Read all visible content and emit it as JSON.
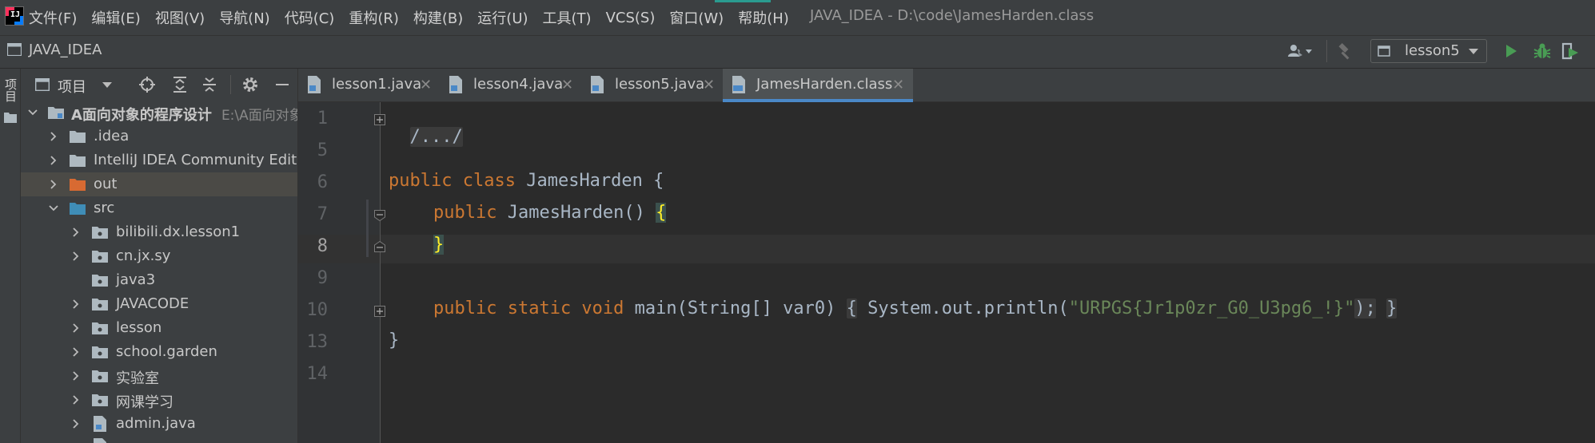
{
  "menu": [
    "文件(F)",
    "编辑(E)",
    "视图(V)",
    "导航(N)",
    "代码(C)",
    "重构(R)",
    "构建(B)",
    "运行(U)",
    "工具(T)",
    "VCS(S)",
    "窗口(W)",
    "帮助(H)"
  ],
  "window_title": "JAVA_IDEA - D:\\code\\JamesHarden.class",
  "nav": {
    "project": "JAVA_IDEA",
    "run_config": "lesson5"
  },
  "tool_strip_label": "项目",
  "project_panel": {
    "title": "项目",
    "tree": [
      {
        "label": "A面向对象的程序设计",
        "hint": "E:\\A面向对象"
      },
      {
        "label": ".idea"
      },
      {
        "label": "IntelliJ IDEA Community Edition"
      },
      {
        "label": "out"
      },
      {
        "label": "src"
      },
      {
        "label": "bilibili.dx.lesson1"
      },
      {
        "label": "cn.jx.sy"
      },
      {
        "label": "java3"
      },
      {
        "label": "JAVACODE"
      },
      {
        "label": "lesson"
      },
      {
        "label": "school.garden"
      },
      {
        "label": "实验室"
      },
      {
        "label": "网课学习"
      },
      {
        "label": "admin.java"
      }
    ]
  },
  "tabs": [
    {
      "label": "lesson1.java"
    },
    {
      "label": "lesson4.java"
    },
    {
      "label": "lesson5.java"
    },
    {
      "label": "JamesHarden.class"
    }
  ],
  "editor": {
    "line_numbers": [
      "1",
      "5",
      "6",
      "7",
      "8",
      "9",
      "10",
      "13",
      "14"
    ],
    "code": {
      "l1": "/.../",
      "l6_kw1": "public",
      "l6_kw2": "class",
      "l6_rest": " JamesHarden {",
      "l7_kw": "public",
      "l7_rest": " JamesHarden() ",
      "l7_brace": "{",
      "l8_brace": "}",
      "l10_kw": "public static void",
      "l10_sig": " main(String[] var0) ",
      "l10_open": "{",
      "l10_call": " System.out.println(",
      "l10_str": "\"URPGS{Jr1p0zr_G0_U3pg6_!}\"",
      "l10_semi": ");",
      "l10_close": "}",
      "l13": "}"
    }
  },
  "colors": {
    "keyword": "#cc7832",
    "string": "#6a8759",
    "selection_tab_underline": "#4a88c7",
    "brace_highlight": "#ffef28"
  }
}
